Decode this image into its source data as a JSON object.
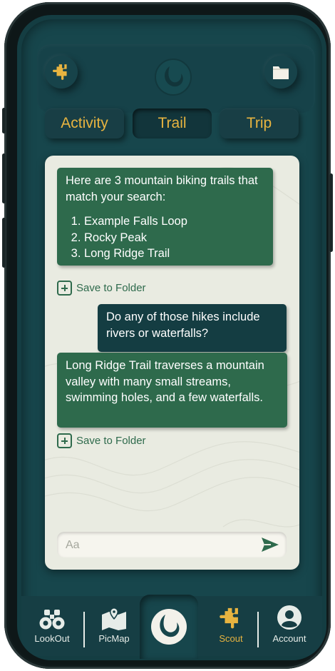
{
  "tabs": [
    {
      "label": "Activity"
    },
    {
      "label": "Trail"
    },
    {
      "label": "Trip"
    }
  ],
  "active_tab": "Trail",
  "chat": {
    "messages": [
      {
        "sender": "bot",
        "text": "Here are 3 mountain biking trails that match your search:",
        "list": [
          "Example Falls Loop",
          "Rocky Peak",
          "Long Ridge Trail"
        ]
      },
      {
        "sender": "user",
        "text": "Do any of those hikes include rivers or waterfalls?"
      },
      {
        "sender": "bot",
        "text": "Long Ridge Trail traverses a mountain valley with many small streams, swimming holes, and a few waterfalls."
      }
    ],
    "save_label": "Save to Folder",
    "input_placeholder": "Aa"
  },
  "nav": {
    "items": [
      {
        "label": "LookOut",
        "icon": "binoculars-icon"
      },
      {
        "label": "PicMap",
        "icon": "map-pin-icon"
      },
      {
        "label": "",
        "icon": "app-logo-icon"
      },
      {
        "label": "Scout",
        "icon": "puzzle-icon"
      },
      {
        "label": "Account",
        "icon": "account-icon"
      }
    ],
    "active": "Scout"
  },
  "colors": {
    "background": "#143d42",
    "accent": "#e8b440",
    "bot_bubble": "#2e6a4c",
    "user_bubble": "#143d42",
    "chat_panel": "#e9ebe1"
  }
}
